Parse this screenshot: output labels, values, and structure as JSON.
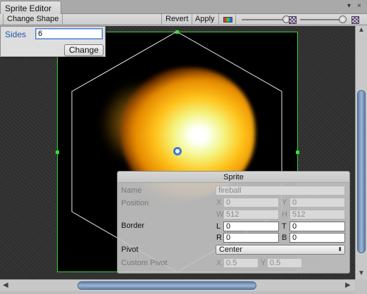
{
  "window": {
    "title": "Sprite Editor",
    "menu_glyph": "▾",
    "close_glyph": "×"
  },
  "toolbar": {
    "change_shape_label": "Change Shape",
    "revert_label": "Revert",
    "apply_label": "Apply",
    "color_toggle_icon": "rgb-channel-icon",
    "zoom_slider_level": 0.95,
    "alpha_slider_level": 0.97,
    "checker_icon": "checkerboard-icon"
  },
  "sides_popup": {
    "label": "Sides",
    "value": "6",
    "button_label": "Change"
  },
  "sprite_panel": {
    "title": "Sprite",
    "name_label": "Name",
    "name_value": "fireball",
    "position_label": "Position",
    "x_label": "X",
    "x_value": "0",
    "y_label": "Y",
    "y_value": "0",
    "w_label": "W",
    "w_value": "512",
    "h_label": "H",
    "h_value": "512",
    "border_label": "Border",
    "l_label": "L",
    "l_value": "0",
    "t_label": "T",
    "t_value": "0",
    "r_label": "R",
    "r_value": "0",
    "b_label": "B",
    "b_value": "0",
    "pivot_label": "Pivot",
    "pivot_value": "Center",
    "pivot_arrow": "⬍",
    "custom_pivot_label": "Custom Pivot",
    "cp_x_label": "X",
    "cp_x_value": "0.5",
    "cp_y_label": "Y",
    "cp_y_value": "0.5"
  },
  "scrollbars": {
    "up_glyph": "▲",
    "down_glyph": "▼",
    "left_glyph": "◀",
    "right_glyph": "▶"
  },
  "colors": {
    "sprite_outline": "#39d039",
    "pivot": "#3b7ad9",
    "scroll_thumb": "#7d99c0"
  }
}
